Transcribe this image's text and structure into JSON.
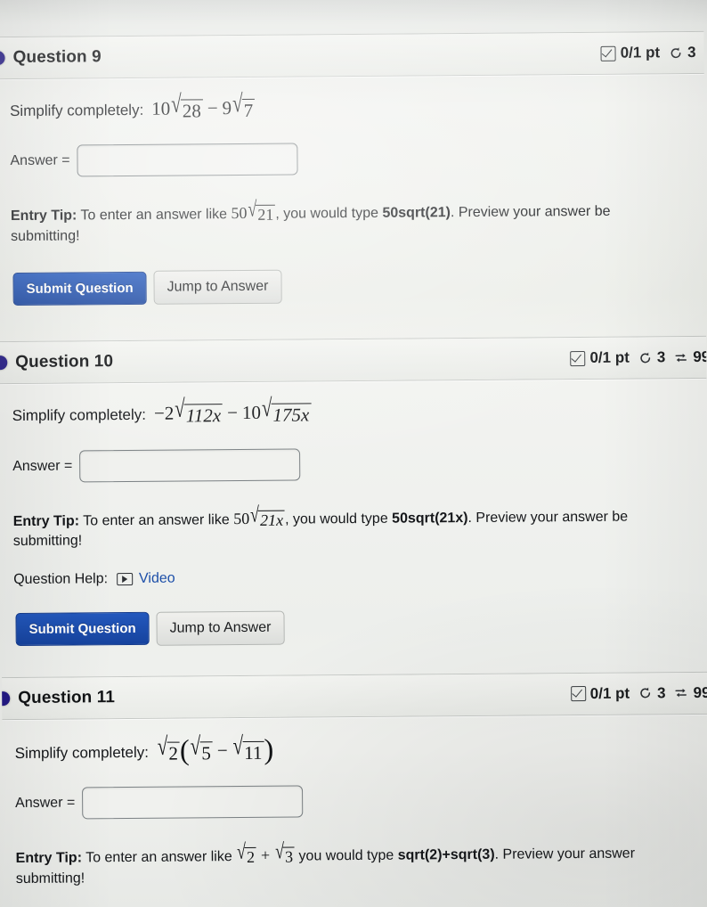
{
  "page": {
    "background_color": "#eceeec",
    "primary_button_color": "#1a4bb0",
    "link_color": "#1b4ea8",
    "bullet_color": "#241a85"
  },
  "common": {
    "answer_label": "Answer =",
    "answer_value": "",
    "answer_placeholder": "",
    "submit_label": "Submit Question",
    "jump_label": "Jump to Answer",
    "prompt_lead": "Simplify completely:",
    "tip_lead": "Entry Tip:",
    "help_label": "Question Help:",
    "video_label": "Video",
    "points_label": "0/1 pt",
    "retry_count": "3",
    "attempts_count": "99"
  },
  "questions": [
    {
      "title": "Question 9",
      "points": "0/1 pt",
      "retries": "3",
      "attempts": "",
      "attempts_trailing": "",
      "expression": {
        "terms": [
          {
            "coef": "10",
            "radicand": "28"
          },
          {
            "op": "−",
            "coef": "9",
            "radicand": "7"
          }
        ]
      },
      "tip": {
        "before": "To enter an answer like",
        "example_coef": "50",
        "example_radicand": "21",
        "middle": ", you would type",
        "code": "50sqrt(21)",
        "after": ". Preview your answer be",
        "second_line": "submitting!"
      },
      "has_help": false
    },
    {
      "title": "Question 10",
      "points": "0/1 pt",
      "retries": "3",
      "attempts": "99",
      "attempts_trailing": "",
      "expression": {
        "terms": [
          {
            "op": "−",
            "coef": "2",
            "radicand": "112x"
          },
          {
            "op": "−",
            "coef": "10",
            "radicand": "175x"
          }
        ]
      },
      "tip": {
        "before": "To enter an answer like",
        "example_coef": "50",
        "example_radicand": "21x",
        "middle": ", you would type",
        "code": "50sqrt(21x)",
        "after": ". Preview your answer be",
        "second_line": "submitting!"
      },
      "has_help": true,
      "help_label": "Question Help:",
      "video_label": "Video"
    },
    {
      "title": "Question 11",
      "points": "0/1 pt",
      "retries": "3",
      "attempts": "99",
      "attempts_trailing": "(",
      "expression": {
        "product": {
          "outer_radicand": "2",
          "inner_left_radicand": "5",
          "inner_op": "−",
          "inner_right_radicand": "11"
        }
      },
      "tip": {
        "before": "To enter an answer like",
        "example_left_radicand": "2",
        "example_op": "+",
        "example_right_radicand": "3",
        "middle": "you would type",
        "code": "sqrt(2)+sqrt(3)",
        "after": ". Preview your answer",
        "second_line": "submitting!"
      },
      "has_help": false
    }
  ]
}
